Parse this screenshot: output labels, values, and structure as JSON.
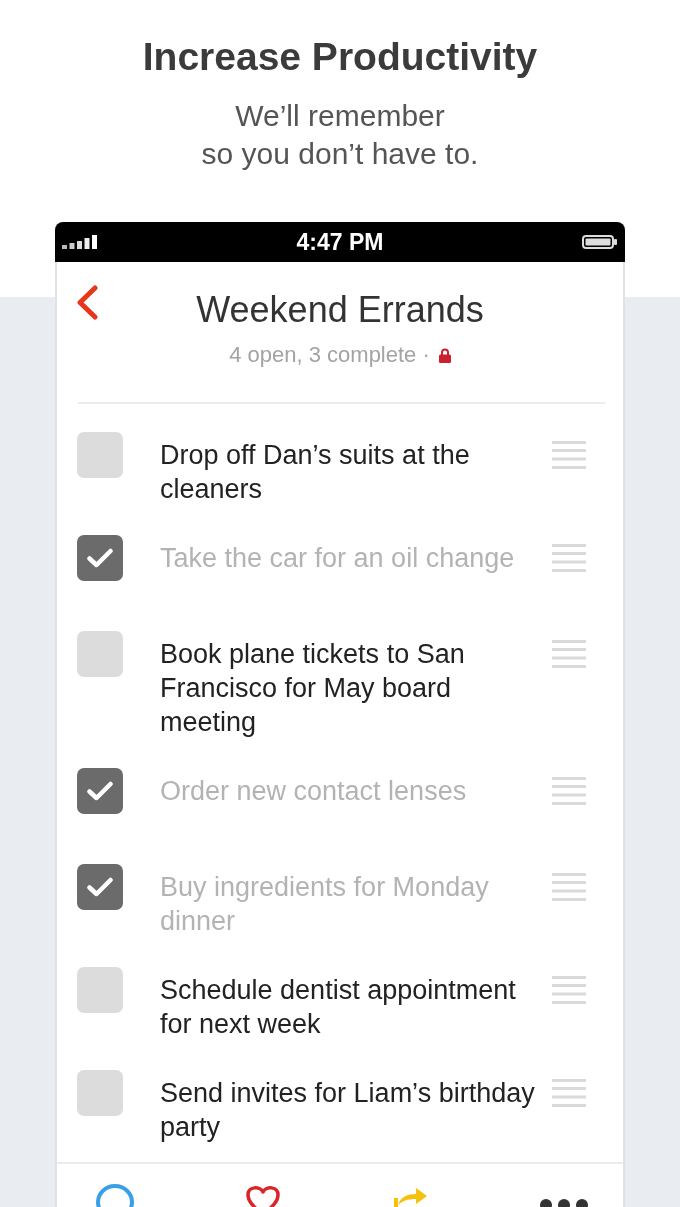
{
  "promo": {
    "headline": "Increase Productivity",
    "tagline": "We’ll remember\nso you don’t have to."
  },
  "status_bar": {
    "time": "4:47 PM"
  },
  "list": {
    "title": "Weekend Errands",
    "summary": "4 open, 3 complete ·"
  },
  "tasks": [
    {
      "text": "Drop off Dan’s suits at the cleaners",
      "checked": false
    },
    {
      "text": "Take the car for an oil change",
      "checked": true
    },
    {
      "text": "Book plane tickets to San Francisco for May board meeting",
      "checked": false
    },
    {
      "text": "Order new contact lenses",
      "checked": true
    },
    {
      "text": "Buy ingredients for Monday dinner",
      "checked": true
    },
    {
      "text": "Schedule dentist appointment for next week",
      "checked": false
    },
    {
      "text": "Send invites for Liam’s birthday party",
      "checked": false
    }
  ]
}
